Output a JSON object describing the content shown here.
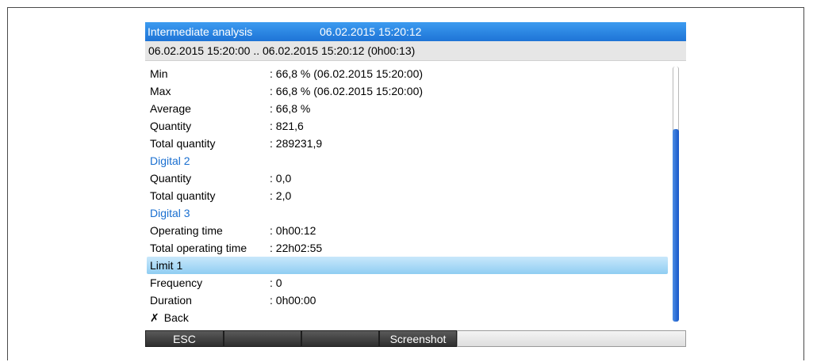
{
  "header": {
    "title": "Intermediate analysis",
    "datetime": "06.02.2015 15:20:12"
  },
  "range": "06.02.2015 15:20:00 .. 06.02.2015 15:20:12 (0h00:13)",
  "rows": [
    {
      "label": "Min",
      "value": ": 66,8 % (06.02.2015 15:20:00)"
    },
    {
      "label": "Max",
      "value": ": 66,8 % (06.02.2015 15:20:00)"
    },
    {
      "label": "Average",
      "value": ": 66,8 %"
    },
    {
      "label": "Quantity",
      "value": ": 821,6"
    },
    {
      "label": "Total quantity",
      "value": ": 289231,9"
    },
    {
      "label": "Digital 2"
    },
    {
      "label": "Quantity",
      "value": ": 0,0"
    },
    {
      "label": "Total quantity",
      "value": ": 2,0"
    },
    {
      "label": "Digital 3"
    },
    {
      "label": "Operating time",
      "value": ": 0h00:12"
    },
    {
      "label": "Total operating time",
      "value": ": 22h02:55"
    },
    {
      "label": "Limit 1"
    },
    {
      "label": "Frequency",
      "value": ": 0"
    },
    {
      "label": "Duration",
      "value": ": 0h00:00"
    },
    {
      "label": "Back"
    }
  ],
  "icons": {
    "back": "x-icon"
  },
  "colors": {
    "title_bar": "#1e74d6",
    "heading_text": "#1a6fd0",
    "selection": "#8fcdf2",
    "scroll_thumb": "#1656c8"
  },
  "softkeys": {
    "key1": "ESC",
    "key2": "",
    "key3": "",
    "key4": "Screenshot",
    "key5": ""
  }
}
